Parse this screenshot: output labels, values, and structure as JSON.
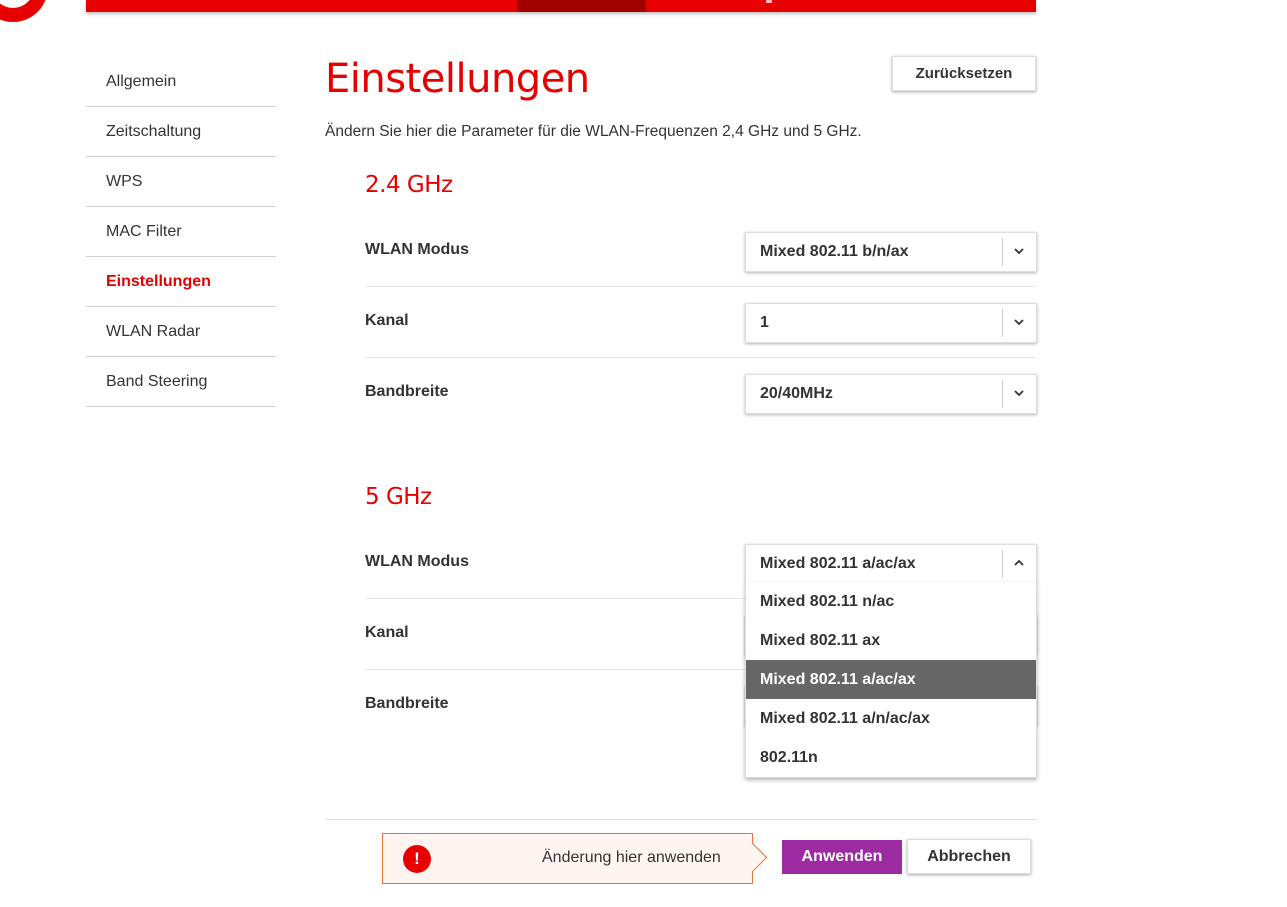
{
  "sidebar": {
    "items": [
      {
        "label": "Allgemein"
      },
      {
        "label": "Zeitschaltung"
      },
      {
        "label": "WPS"
      },
      {
        "label": "MAC Filter"
      },
      {
        "label": "Einstellungen"
      },
      {
        "label": "WLAN Radar"
      },
      {
        "label": "Band Steering"
      }
    ],
    "active": "Einstellungen"
  },
  "page": {
    "title": "Einstellungen",
    "reset_label": "Zurücksetzen",
    "intro": "Ändern Sie hier die Parameter für die WLAN-Frequenzen 2,4 GHz und 5 GHz."
  },
  "band24": {
    "title": "2.4 GHz",
    "mode_label": "WLAN Modus",
    "mode_value": "Mixed 802.11 b/n/ax",
    "channel_label": "Kanal",
    "channel_value": "1",
    "bandwidth_label": "Bandbreite",
    "bandwidth_value": "20/40MHz"
  },
  "band5": {
    "title": "5 GHz",
    "mode_label": "WLAN Modus",
    "mode_value": "Mixed 802.11 a/ac/ax",
    "channel_label": "Kanal",
    "bandwidth_label": "Bandbreite",
    "mode_options": [
      "Mixed 802.11 n/ac",
      "Mixed 802.11 ax",
      "Mixed 802.11 a/ac/ax",
      "Mixed 802.11 a/n/ac/ax",
      "802.11n"
    ],
    "mode_selected": "Mixed 802.11 a/ac/ax"
  },
  "footer": {
    "notice": "Änderung hier anwenden",
    "warning_glyph": "!",
    "apply_label": "Anwenden",
    "cancel_label": "Abbrechen"
  },
  "colors": {
    "brand_red": "#e60000",
    "apply_purple": "#9c2aa0",
    "selected_option": "#666666"
  }
}
